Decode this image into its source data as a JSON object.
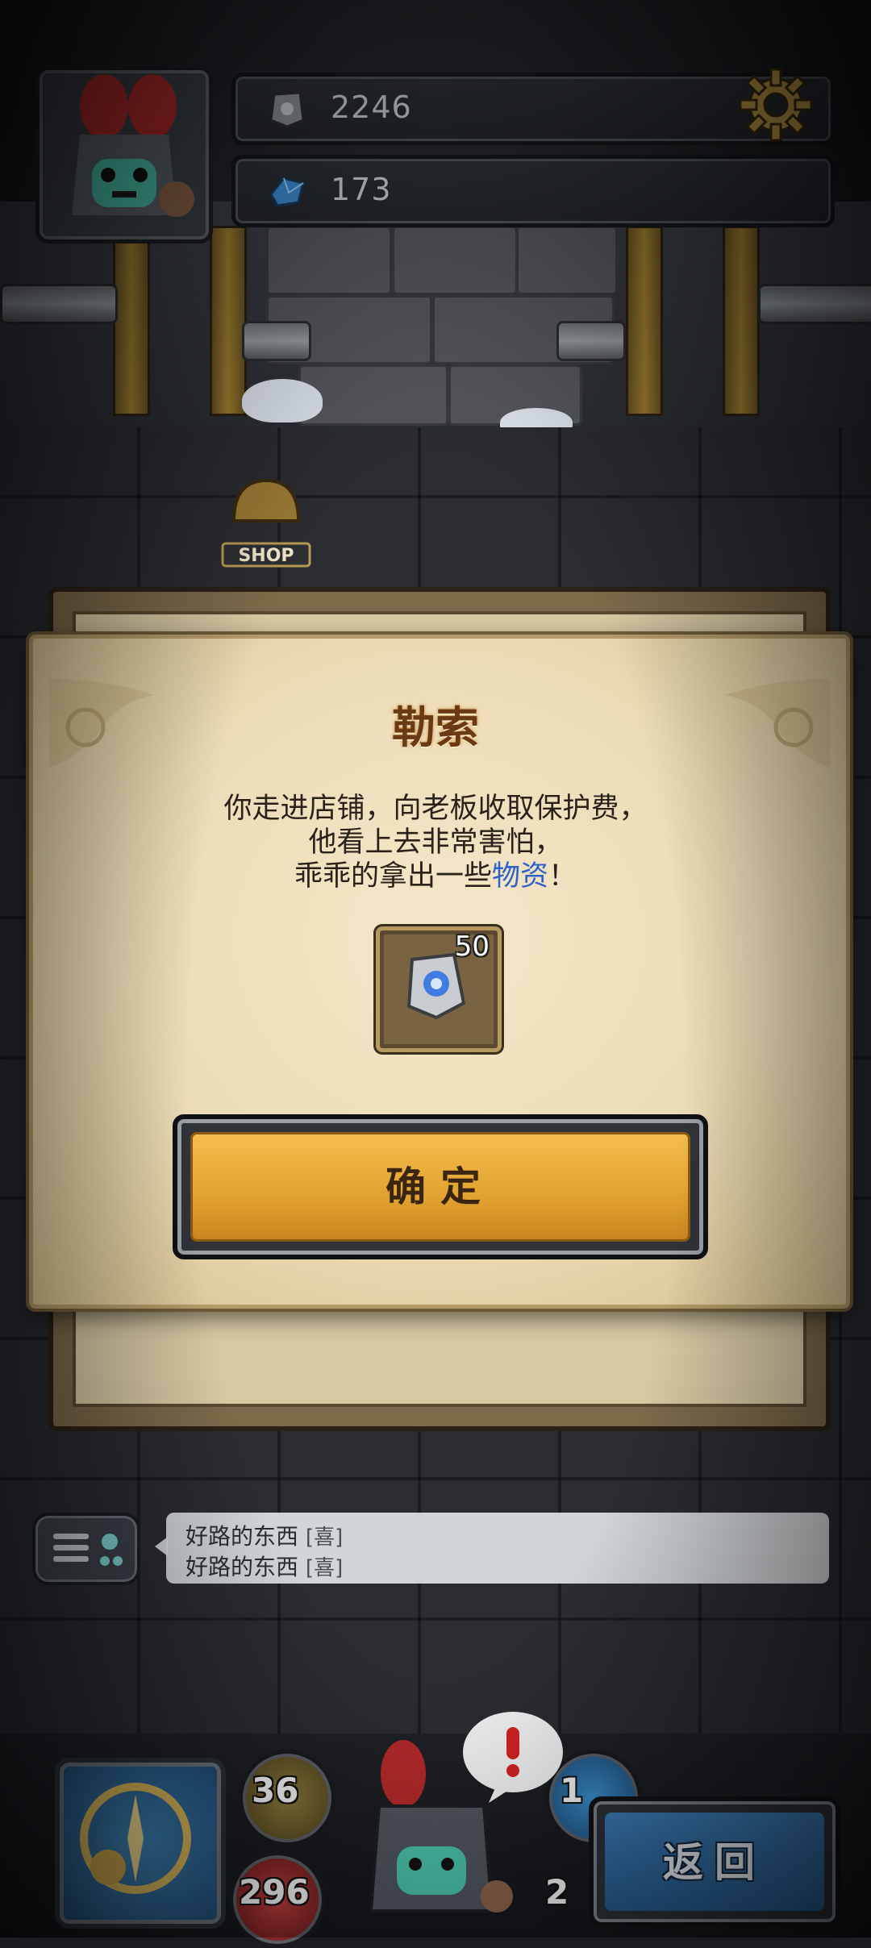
{
  "hud": {
    "stone_count": "2246",
    "gem_count": "173"
  },
  "scene": {
    "shop_sign": "SHOP"
  },
  "dialog": {
    "title": "勒索",
    "message_line1": "你走进店铺，向老板收取保护费，",
    "message_line2": "他看上去非常害怕，",
    "message_line3_prefix": "乖乖的拿出一些",
    "message_line3_highlight": "物资",
    "message_line3_suffix": "！",
    "reward_count": "50",
    "reward_icon": "rune-stone-icon",
    "confirm_label": "确定"
  },
  "chat": {
    "lines": [
      {
        "text": "好路的东西",
        "tag": "[喜]"
      },
      {
        "text": "好路的东西",
        "tag": "[喜]"
      }
    ]
  },
  "bottom": {
    "attack": "36",
    "hp": "296",
    "defense_partial": "1",
    "other_partial": "2",
    "back_label": "返回"
  },
  "colors": {
    "title": "#6b3a14",
    "highlight": "#2d62c8",
    "confirm_button": "#e2a22f",
    "back_button": "#2f6aa3"
  }
}
